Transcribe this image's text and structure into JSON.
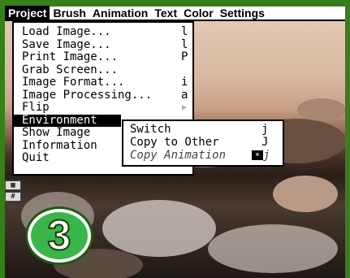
{
  "menubar": {
    "items": [
      "Project",
      "Brush",
      "Animation",
      "Text",
      "Color",
      "Settings"
    ]
  },
  "project_menu": {
    "items": [
      {
        "label": "Load Image...",
        "shortcut": "l"
      },
      {
        "label": "Save Image...",
        "shortcut": "l"
      },
      {
        "label": "Print Image...",
        "shortcut": "P"
      },
      {
        "label": "Grab Screen...",
        "shortcut": ""
      },
      {
        "label": "Image Format...",
        "shortcut": "i"
      },
      {
        "label": "Image Processing...",
        "shortcut": "a"
      },
      {
        "label": "Flip",
        "shortcut": ""
      },
      {
        "label": "Environment",
        "shortcut": ""
      },
      {
        "label": "Show Image",
        "shortcut": ""
      },
      {
        "label": "Information",
        "shortcut": ""
      },
      {
        "label": "Quit",
        "shortcut": ""
      }
    ]
  },
  "environment_submenu": {
    "items": [
      {
        "label": "Switch",
        "shortcut": "j"
      },
      {
        "label": "Copy to Other",
        "shortcut": "J"
      },
      {
        "label": "Copy Animation",
        "shortcut": "j"
      }
    ],
    "copy_animation_key": "⌘"
  },
  "badge": {
    "number": "3"
  },
  "colors": {
    "background": "#36801a",
    "badge": "#39b54a",
    "menu_selected": "#000000"
  }
}
